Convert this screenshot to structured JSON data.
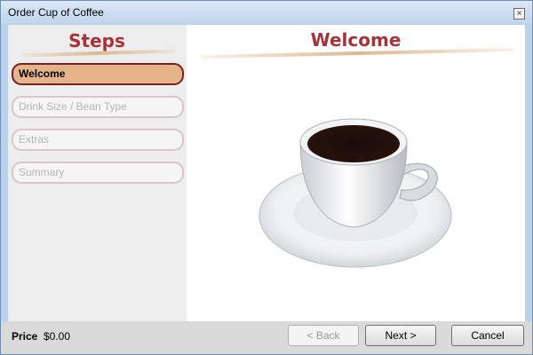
{
  "window": {
    "title": "Order Cup of Coffee",
    "close_glyph": "×"
  },
  "sidebar": {
    "title": "Steps",
    "steps": [
      {
        "label": "Welcome",
        "active": true
      },
      {
        "label": "Drink Size / Bean Type",
        "active": false
      },
      {
        "label": "Extras",
        "active": false
      },
      {
        "label": "Summary",
        "active": false
      }
    ]
  },
  "main": {
    "title": "Welcome",
    "image": "coffee-cup-illustration"
  },
  "footer": {
    "price_label": "Price",
    "price_value": "$0.00",
    "back_label": "< Back",
    "next_label": "Next >",
    "cancel_label": "Cancel"
  },
  "colors": {
    "accent_title": "#a63338",
    "active_step": "#e5b488",
    "active_step_border": "#7a1f24"
  }
}
